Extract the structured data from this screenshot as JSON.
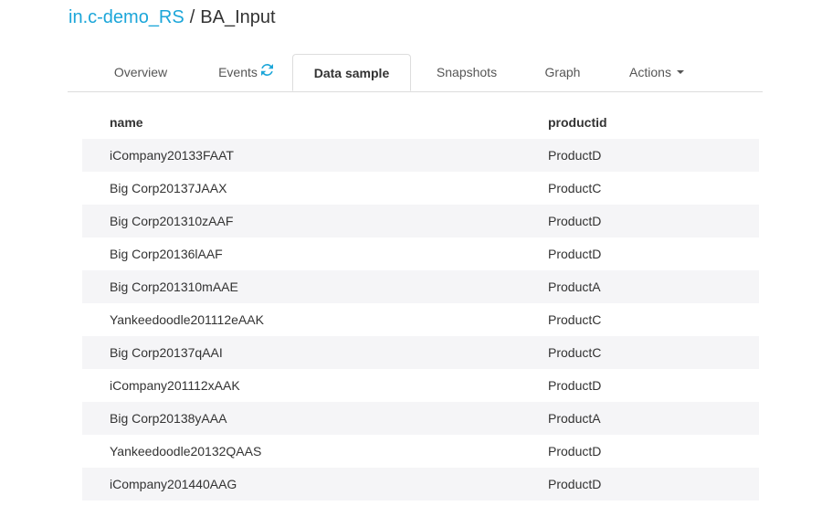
{
  "breadcrumb": {
    "bucket": "in.c-demo_RS",
    "separator": "/",
    "table": "BA_Input"
  },
  "tabs": [
    {
      "label": "Overview"
    },
    {
      "label": "Events",
      "icon": "refresh-icon"
    },
    {
      "label": "Data sample",
      "active": true
    },
    {
      "label": "Snapshots"
    },
    {
      "label": "Graph"
    },
    {
      "label": "Actions",
      "icon": "caret-down-icon"
    }
  ],
  "colors": {
    "link": "#1ca6d9",
    "stripe": "#f5f5f7",
    "border": "#dddddd"
  },
  "table": {
    "columns": [
      "name",
      "productid"
    ],
    "rows": [
      [
        "iCompany20133FAAT",
        "ProductD"
      ],
      [
        "Big Corp20137JAAX",
        "ProductC"
      ],
      [
        "Big Corp201310zAAF",
        "ProductD"
      ],
      [
        "Big Corp20136lAAF",
        "ProductD"
      ],
      [
        "Big Corp201310mAAE",
        "ProductA"
      ],
      [
        "Yankeedoodle201112eAAK",
        "ProductC"
      ],
      [
        "Big Corp20137qAAI",
        "ProductC"
      ],
      [
        "iCompany201112xAAK",
        "ProductD"
      ],
      [
        "Big Corp20138yAAA",
        "ProductA"
      ],
      [
        "Yankeedoodle20132QAAS",
        "ProductD"
      ],
      [
        "iCompany201440AAG",
        "ProductD"
      ]
    ]
  }
}
